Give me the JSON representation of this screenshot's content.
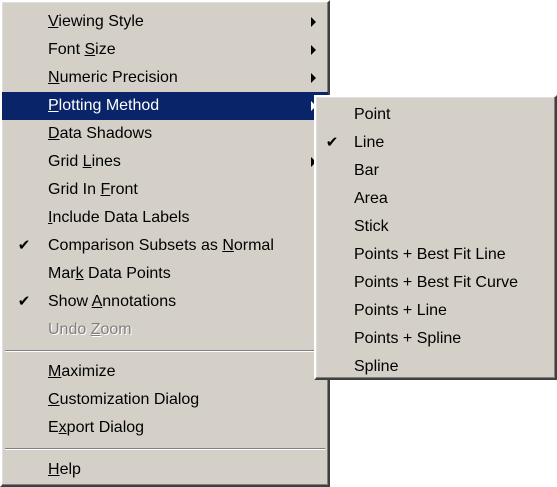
{
  "main_menu": {
    "items": [
      {
        "label": "Viewing Style",
        "accel_index": 0,
        "submenu": true,
        "checked": false,
        "disabled": false
      },
      {
        "label": "Font Size",
        "accel_index": 5,
        "submenu": true,
        "checked": false,
        "disabled": false
      },
      {
        "label": "Numeric Precision",
        "accel_index": 0,
        "submenu": true,
        "checked": false,
        "disabled": false
      },
      {
        "label": "Plotting Method",
        "accel_index": 0,
        "submenu": true,
        "checked": false,
        "disabled": false,
        "highlighted": true
      },
      {
        "label": "Data Shadows",
        "accel_index": 0,
        "submenu": false,
        "checked": false,
        "disabled": false
      },
      {
        "label": "Grid Lines",
        "accel_index": 5,
        "submenu": true,
        "checked": false,
        "disabled": false
      },
      {
        "label": "Grid In Front",
        "accel_index": 8,
        "submenu": false,
        "checked": false,
        "disabled": false
      },
      {
        "label": "Include Data Labels",
        "accel_index": 0,
        "submenu": false,
        "checked": false,
        "disabled": false
      },
      {
        "label": "Comparison Subsets as Normal",
        "accel_index": 22,
        "submenu": false,
        "checked": true,
        "disabled": false
      },
      {
        "label": "Mark Data Points",
        "accel_index": 3,
        "submenu": false,
        "checked": false,
        "disabled": false
      },
      {
        "label": "Show Annotations",
        "accel_index": 5,
        "submenu": false,
        "checked": true,
        "disabled": false
      },
      {
        "label": "Undo Zoom",
        "accel_index": 5,
        "submenu": false,
        "checked": false,
        "disabled": true
      },
      {
        "separator": true
      },
      {
        "label": "Maximize",
        "accel_index": 0,
        "submenu": false,
        "checked": false,
        "disabled": false
      },
      {
        "label": "Customization Dialog",
        "accel_index": 0,
        "submenu": false,
        "checked": false,
        "disabled": false
      },
      {
        "label": "Export Dialog",
        "accel_index": 1,
        "submenu": false,
        "checked": false,
        "disabled": false
      },
      {
        "separator": true
      },
      {
        "label": "Help",
        "accel_index": 0,
        "submenu": false,
        "checked": false,
        "disabled": false
      }
    ]
  },
  "plotting_submenu": {
    "items": [
      {
        "label": "Point",
        "checked": false
      },
      {
        "label": "Line",
        "checked": true
      },
      {
        "label": "Bar",
        "checked": false
      },
      {
        "label": "Area",
        "checked": false
      },
      {
        "label": "Stick",
        "checked": false
      },
      {
        "label": "Points + Best Fit Line",
        "checked": false
      },
      {
        "label": "Points + Best Fit Curve",
        "checked": false
      },
      {
        "label": "Points + Line",
        "checked": false
      },
      {
        "label": "Points + Spline",
        "checked": false
      },
      {
        "label": "Spline",
        "checked": false
      }
    ]
  },
  "icons": {
    "check": "check-icon",
    "submenu_arrow": "submenu-arrow-icon"
  },
  "colors": {
    "menu_bg": "#d4d0c8",
    "highlight_bg": "#0a246a",
    "highlight_text": "#ffffff",
    "disabled_text": "#808080"
  }
}
